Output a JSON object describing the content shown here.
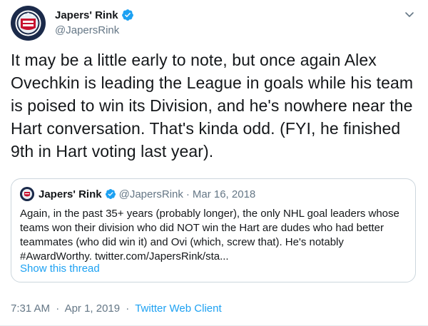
{
  "author": {
    "name": "Japers' Rink",
    "handle": "@JapersRink",
    "verified": true,
    "avatar_icon": "japers-rink-logo-icon"
  },
  "tweet": {
    "text": "It may be a little early to note, but once again Alex Ovechkin is leading the League in goals while his team is poised to win its Division, and he's nowhere near the Hart conversation. That's kinda odd. (FYI, he finished 9th in Hart voting last year).",
    "time": "7:31 AM",
    "date": "Apr 1, 2019",
    "separator": "·",
    "client": "Twitter Web Client"
  },
  "quoted": {
    "name": "Japers' Rink",
    "handle": "@JapersRink",
    "separator": "·",
    "date": "Mar 16, 2018",
    "text": "Again, in the past 35+ years (probably longer), the only NHL goal leaders whose teams won their division who did NOT win the Hart are dudes who had better teammates (who did win it) and Ovi (which, screw that). He's notably #AwardWorthy. twitter.com/JapersRink/sta...",
    "show_thread": "Show this thread"
  },
  "colors": {
    "link": "#1da1f2",
    "muted": "#657786",
    "border": "#ccd6dd",
    "verified": "#1da1f2"
  }
}
